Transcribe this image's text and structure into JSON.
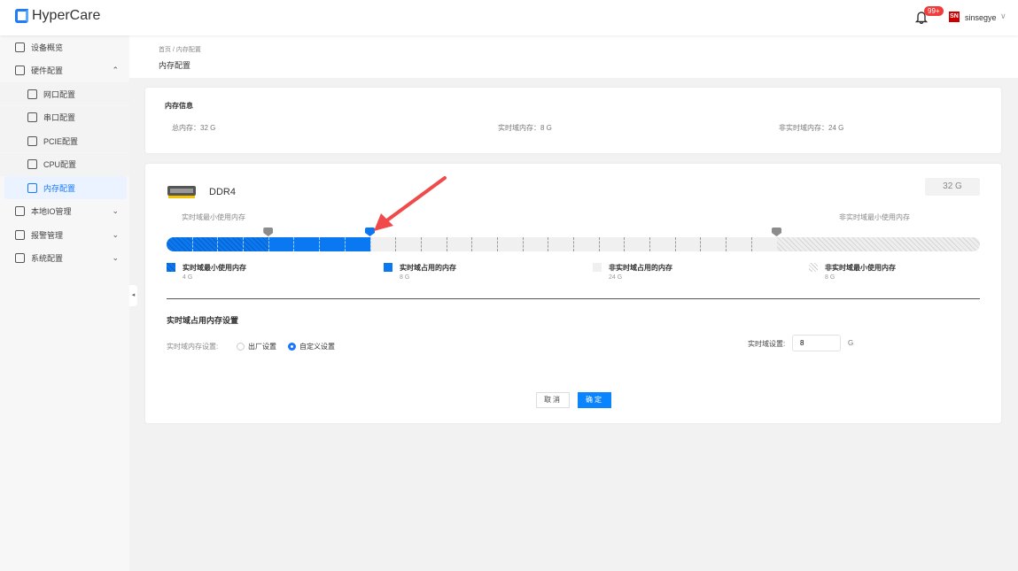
{
  "app": {
    "name": "HyperCare"
  },
  "header": {
    "badge": "99+",
    "avatar": "SN",
    "username": "sinsegye"
  },
  "sidebar": {
    "items": [
      {
        "label": "设备概览",
        "name": "overview"
      },
      {
        "label": "硬件配置",
        "name": "hardware",
        "chev": "⌃"
      },
      {
        "label": "网口配置",
        "name": "network",
        "sub": true
      },
      {
        "label": "串口配置",
        "name": "serial",
        "sub": true
      },
      {
        "label": "PCIE配置",
        "name": "pcie",
        "sub": true
      },
      {
        "label": "CPU配置",
        "name": "cpu",
        "sub": true
      },
      {
        "label": "内存配置",
        "name": "memory",
        "sub": true,
        "active": true
      },
      {
        "label": "本地IO管理",
        "name": "local-io",
        "chev": "⌄"
      },
      {
        "label": "报警管理",
        "name": "alarm",
        "chev": "⌄"
      },
      {
        "label": "系统配置",
        "name": "system",
        "chev": "⌄"
      }
    ]
  },
  "breadcrumb": {
    "home": "首页",
    "sep": "/",
    "current": "内存配置"
  },
  "page_title": "内存配置",
  "info": {
    "title": "内存信息",
    "total": "总内存：32 G",
    "rt": "实时域内存：8 G",
    "nonrt": "非实时域内存：24 G"
  },
  "memory": {
    "type": "DDR4",
    "size": "32 G",
    "rt_min_label": "实时域最小使用内存",
    "nonrt_min_label": "非实时域最小使用内存",
    "total_g": 32,
    "rt_min_g": 4,
    "rt_used_g": 8,
    "nonrt_min_g": 8,
    "colors": {
      "blue": "#0a78f0",
      "gray": "#f0f0f0",
      "marker": "#8c8c8c"
    },
    "legend": [
      {
        "label": "实时域最小使用内存",
        "value": "4 G"
      },
      {
        "label": "实时域占用的内存",
        "value": "8 G"
      },
      {
        "label": "非实时域占用的内存",
        "value": "24 G"
      },
      {
        "label": "非实时域最小使用内存",
        "value": "8 G"
      }
    ]
  },
  "settings": {
    "title": "实时域占用内存设置",
    "mode_label": "实时域内存设置:",
    "factory": "出厂设置",
    "custom": "自定义设置",
    "rt_label": "实时域设置:",
    "rt_value": "8",
    "unit": "G"
  },
  "buttons": {
    "cancel": "取消",
    "ok": "确定"
  }
}
